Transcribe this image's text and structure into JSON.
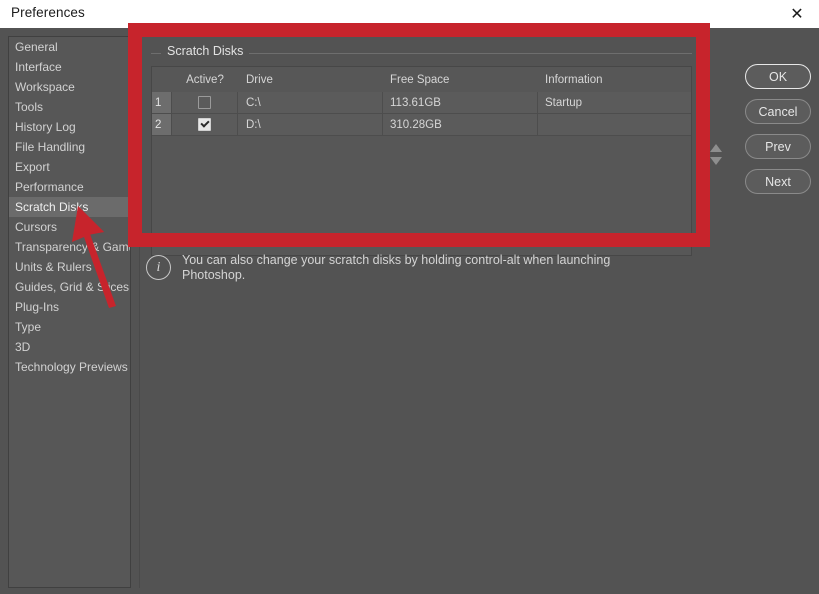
{
  "window": {
    "title": "Preferences",
    "close_icon": "close-icon"
  },
  "sidebar": {
    "items": [
      {
        "label": "General",
        "selected": false
      },
      {
        "label": "Interface",
        "selected": false
      },
      {
        "label": "Workspace",
        "selected": false
      },
      {
        "label": "Tools",
        "selected": false
      },
      {
        "label": "History Log",
        "selected": false
      },
      {
        "label": "File Handling",
        "selected": false
      },
      {
        "label": "Export",
        "selected": false
      },
      {
        "label": "Performance",
        "selected": false
      },
      {
        "label": "Scratch Disks",
        "selected": true
      },
      {
        "label": "Cursors",
        "selected": false
      },
      {
        "label": "Transparency & Gamut",
        "selected": false
      },
      {
        "label": "Units & Rulers",
        "selected": false
      },
      {
        "label": "Guides, Grid & Slices",
        "selected": false
      },
      {
        "label": "Plug-Ins",
        "selected": false
      },
      {
        "label": "Type",
        "selected": false
      },
      {
        "label": "3D",
        "selected": false
      },
      {
        "label": "Technology Previews",
        "selected": false
      }
    ]
  },
  "panel": {
    "group_title": "Scratch Disks",
    "table": {
      "headers": [
        "",
        "Active?",
        "Drive",
        "Free Space",
        "Information"
      ],
      "rows": [
        {
          "num": "1",
          "active": false,
          "drive": "C:\\",
          "free_space": "113.61GB",
          "information": "Startup"
        },
        {
          "num": "2",
          "active": true,
          "drive": "D:\\",
          "free_space": "310.28GB",
          "information": ""
        }
      ]
    },
    "spinner": {
      "up_icon": "triangle-up-icon",
      "down_icon": "triangle-down-icon"
    },
    "note": {
      "icon": "info-circle-icon",
      "text": "You can also change your scratch disks by holding control-alt when launching Photoshop."
    }
  },
  "buttons": {
    "ok": "OK",
    "cancel": "Cancel",
    "prev": "Prev",
    "next": "Next"
  },
  "annotation": {
    "highlight_color": "#c7242c",
    "arrow_color": "#c7242c"
  }
}
